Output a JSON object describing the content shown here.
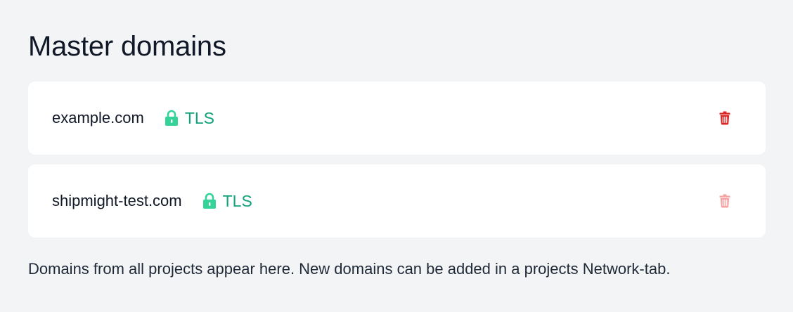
{
  "page": {
    "title": "Master domains"
  },
  "domains": [
    {
      "name": "example.com",
      "tls_label": "TLS",
      "lock_icon": "lock-icon",
      "delete_icon": "trash-icon",
      "delete_enabled": true
    },
    {
      "name": "shipmight-test.com",
      "tls_label": "TLS",
      "lock_icon": "lock-icon",
      "delete_icon": "trash-icon",
      "delete_enabled": false
    }
  ],
  "help_text": "Domains from all projects appear here. New domains can be added in a projects Network-tab.",
  "colors": {
    "background": "#f3f4f6",
    "card": "#ffffff",
    "tls_green": "#10a37a",
    "lock_green": "#34d399",
    "delete_red": "#dc2626",
    "delete_red_disabled": "#f5a3a3"
  }
}
